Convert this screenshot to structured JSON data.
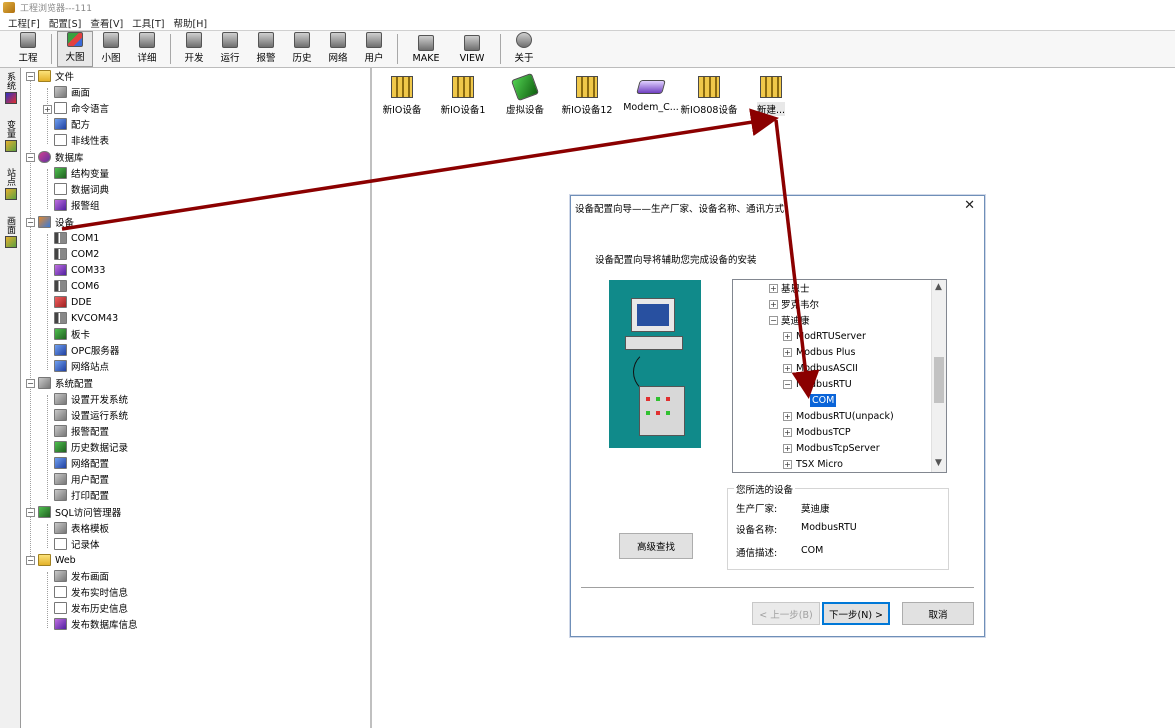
{
  "window": {
    "title": "工程浏览器---111"
  },
  "menu": [
    "工程[F]",
    "配置[S]",
    "查看[V]",
    "工具[T]",
    "帮助[H]"
  ],
  "toolbar": {
    "group1": [
      "工程"
    ],
    "group2": [
      "大图",
      "小图",
      "详细"
    ],
    "group3": [
      "开发",
      "运行",
      "报警",
      "历史",
      "网络",
      "用户"
    ],
    "group4": [
      "MAKE",
      "VIEW"
    ],
    "group5": [
      "关于"
    ]
  },
  "side_tabs": [
    "系统",
    "变量",
    "站点",
    "画面"
  ],
  "tree": {
    "file": "文件",
    "file_children": [
      "画面",
      "命令语言",
      "配方",
      "非线性表"
    ],
    "database": "数据库",
    "database_children": [
      "结构变量",
      "数据词典",
      "报警组"
    ],
    "devices": "设备",
    "devices_children": [
      "COM1",
      "COM2",
      "COM33",
      "COM6",
      "DDE",
      "KVCOM43",
      "板卡",
      "OPC服务器",
      "网络站点"
    ],
    "sysconfig": "系统配置",
    "sysconfig_children": [
      "设置开发系统",
      "设置运行系统",
      "报警配置",
      "历史数据记录",
      "网络配置",
      "用户配置",
      "打印配置"
    ],
    "sql": "SQL访问管理器",
    "sql_children": [
      "表格模板",
      "记录体"
    ],
    "web": "Web",
    "web_children": [
      "发布画面",
      "发布实时信息",
      "发布历史信息",
      "发布数据库信息"
    ]
  },
  "devices": [
    "新IO设备",
    "新IO设备1",
    "虚拟设备",
    "新IO设备12",
    "Modem_C...",
    "新IO808设备",
    "新建..."
  ],
  "dialog": {
    "title": "设备配置向导——生产厂家、设备名称、通讯方式",
    "close": "✕",
    "intro": "设备配置向导将辅助您完成设备的安装",
    "tree": [
      "基恩士",
      "罗克韦尔",
      "莫迪康",
      "ModRTUServer",
      "Modbus Plus",
      "ModbusASCII",
      "ModbusRTU",
      "COM",
      "ModbusRTU(unpack)",
      "ModbusTCP",
      "ModbusTcpServer",
      "TSX Micro"
    ],
    "selected_group": "您所选的设备",
    "fields": [
      {
        "label": "生产厂家:",
        "value": "莫迪康"
      },
      {
        "label": "设备名称:",
        "value": "ModbusRTU"
      },
      {
        "label": "通信描述:",
        "value": "COM"
      }
    ],
    "advanced_button": "高级查找",
    "back_button": "< 上一步(B)",
    "next_button": "下一步(N) >",
    "cancel_button": "取消"
  },
  "colors": {
    "annotation_arrow": "#8b0000",
    "selection": "#0a64d8",
    "illustration_bg": "#108a8a"
  }
}
